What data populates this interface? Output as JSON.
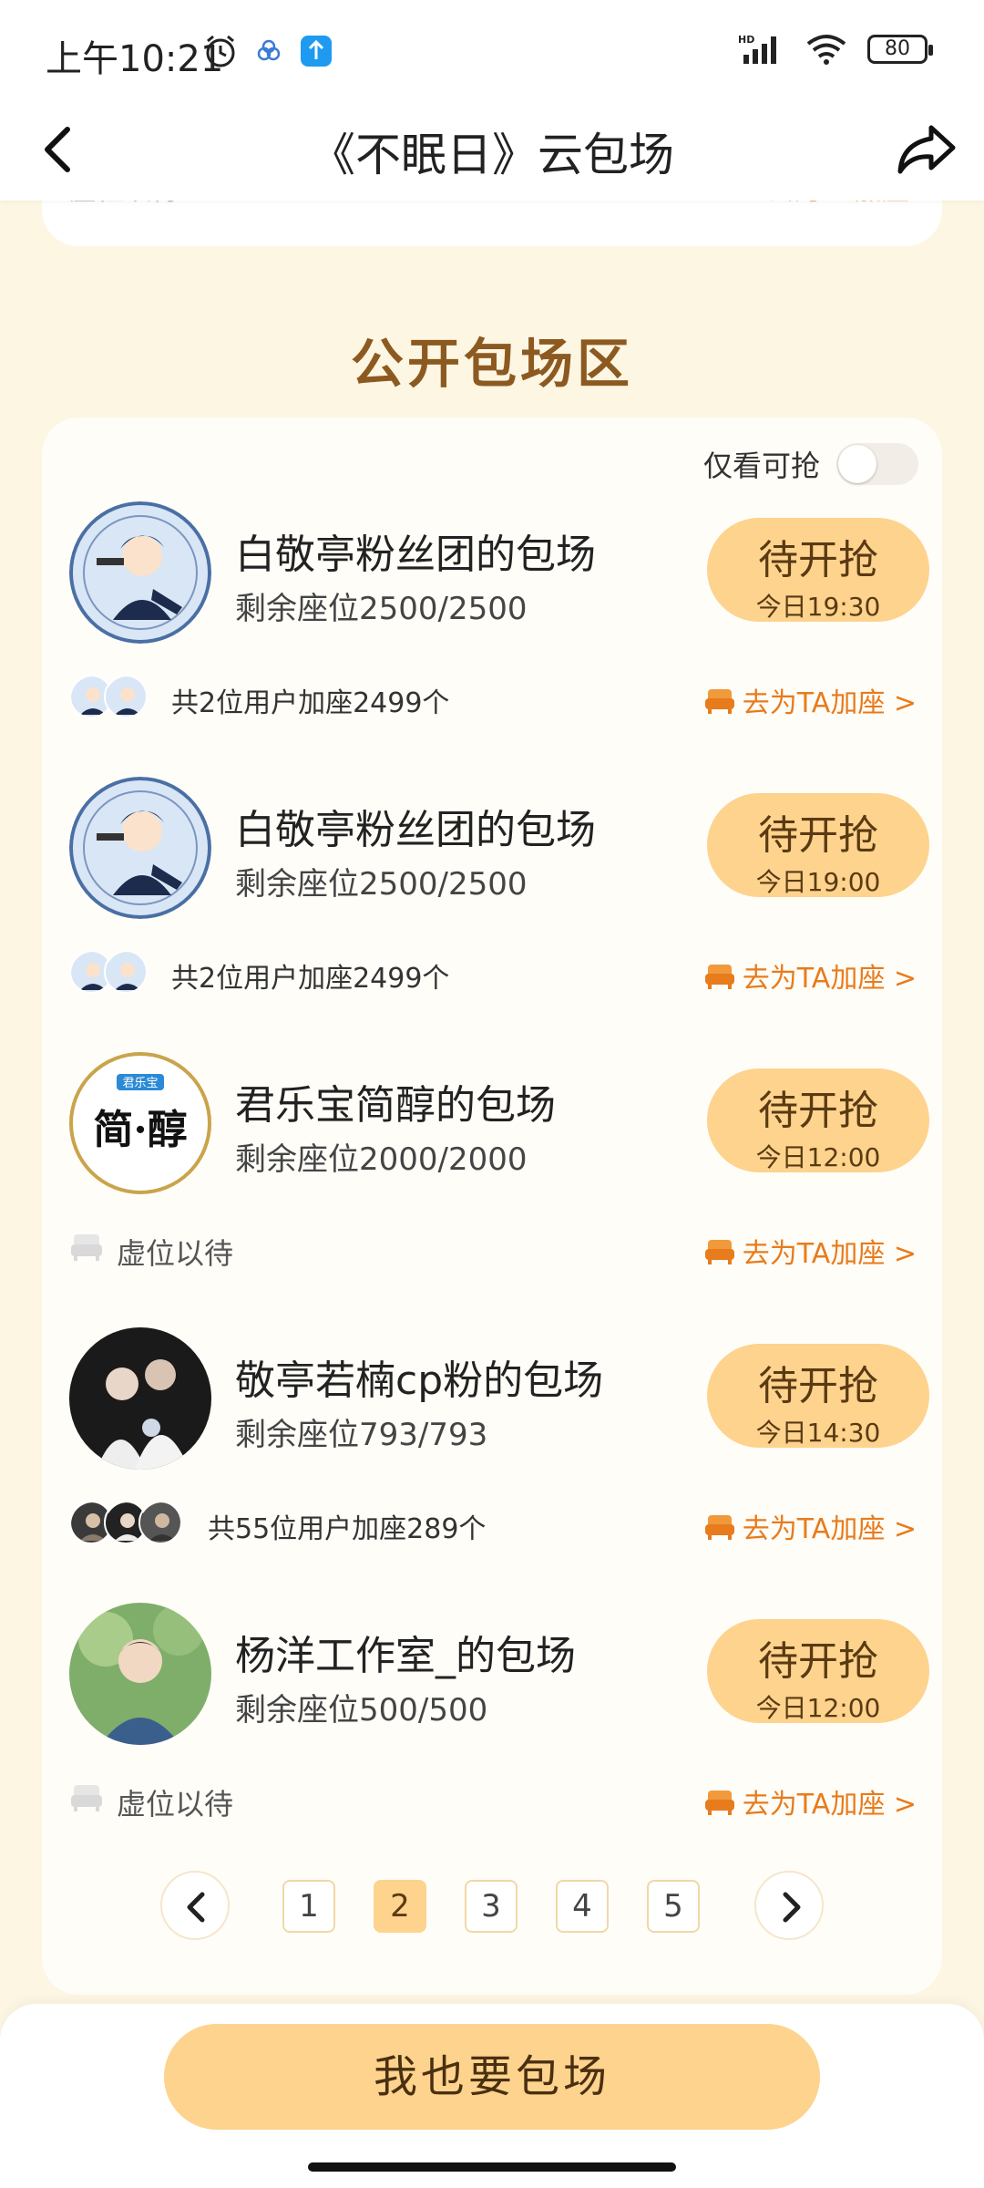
{
  "status_bar": {
    "time": "上午10:21",
    "battery": "80",
    "network": "HD"
  },
  "nav": {
    "title": "《不眠日》云包场"
  },
  "prev_card": {
    "left_text": "虚位以待",
    "right_text": "去为TA加座"
  },
  "section": {
    "title": "公开包场区"
  },
  "filter": {
    "label": "仅看可抢",
    "enabled": false
  },
  "items": [
    {
      "title": "白敬亭粉丝团的包场",
      "seats": "剩余座位2500/2500",
      "button": "待开抢",
      "time": "今日19:30",
      "footer": "共2位用户加座2499个",
      "link": "去为TA加座 >"
    },
    {
      "title": "白敬亭粉丝团的包场",
      "seats": "剩余座位2500/2500",
      "button": "待开抢",
      "time": "今日19:00",
      "footer": "共2位用户加座2499个",
      "link": "去为TA加座 >"
    },
    {
      "title": "君乐宝简醇的包场",
      "seats": "剩余座位2000/2000",
      "button": "待开抢",
      "time": "今日12:00",
      "footer": "虚位以待",
      "link": "去为TA加座 >",
      "logo_text_top": "君乐宝",
      "logo_text_main": "简·醇"
    },
    {
      "title": "敬亭若楠cp粉的包场",
      "seats": "剩余座位793/793",
      "button": "待开抢",
      "time": "今日14:30",
      "footer": "共55位用户加座289个",
      "link": "去为TA加座 >"
    },
    {
      "title": "杨洋工作室_的包场",
      "seats": "剩余座位500/500",
      "button": "待开抢",
      "time": "今日12:00",
      "footer": "虚位以待",
      "link": "去为TA加座 >"
    }
  ],
  "pager": {
    "pages": [
      "1",
      "2",
      "3",
      "4",
      "5"
    ],
    "current": "2"
  },
  "cta": {
    "label": "我也要包场"
  },
  "colors": {
    "accent": "#fdd38e",
    "link": "#e87b1c",
    "section_title": "#8c5a21",
    "background": "#fdf6e3"
  }
}
